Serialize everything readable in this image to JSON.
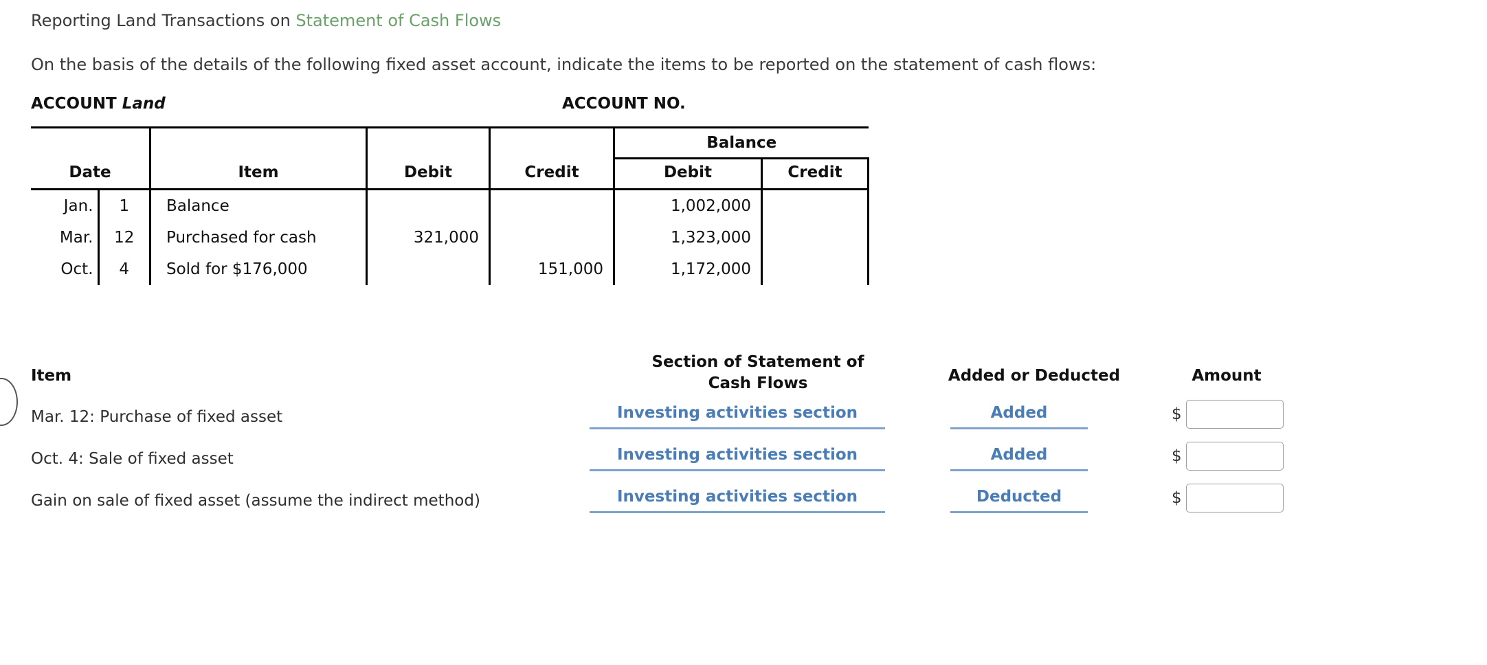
{
  "header": {
    "title_prefix": "Reporting Land Transactions on ",
    "title_link": "Statement of Cash Flows",
    "instructions": "On the basis of the details of the following fixed asset account, indicate the items to be reported on the statement of cash flows:"
  },
  "account": {
    "label": "ACCOUNT ",
    "name": "Land",
    "account_no_label": "ACCOUNT NO."
  },
  "ledger": {
    "balance_group_header": "Balance",
    "columns": {
      "date": "Date",
      "item": "Item",
      "debit": "Debit",
      "credit": "Credit",
      "bal_debit": "Debit",
      "bal_credit": "Credit"
    },
    "rows": [
      {
        "month": "Jan.",
        "day": "1",
        "item": "Balance",
        "debit": "",
        "credit": "",
        "bal_debit": "1,002,000",
        "bal_credit": ""
      },
      {
        "month": "Mar.",
        "day": "12",
        "item": "Purchased for cash",
        "debit": "321,000",
        "credit": "",
        "bal_debit": "1,323,000",
        "bal_credit": ""
      },
      {
        "month": "Oct.",
        "day": "4",
        "item": "Sold for $176,000",
        "debit": "",
        "credit": "151,000",
        "bal_debit": "1,172,000",
        "bal_credit": ""
      }
    ]
  },
  "answers": {
    "headers": {
      "item": "Item",
      "section_line1": "Section of Statement of",
      "section_line2": "Cash Flows",
      "added_or_deducted": "Added or Deducted",
      "amount": "Amount"
    },
    "currency_symbol": "$",
    "rows": [
      {
        "label": "Mar. 12: Purchase of fixed asset",
        "section": "Investing activities section",
        "added_or_deducted": "Added",
        "amount": "",
        "amount_placeholder": ""
      },
      {
        "label": "Oct. 4: Sale of fixed asset",
        "section": "Investing activities section",
        "added_or_deducted": "Added",
        "amount": "",
        "amount_placeholder": ""
      },
      {
        "label": "Gain on sale of fixed asset (assume the indirect method)",
        "section": "Investing activities section",
        "added_or_deducted": "Deducted",
        "amount": "",
        "amount_placeholder": ""
      }
    ]
  },
  "colors": {
    "link_green": "#6aa06a",
    "select_blue": "#4a7db5",
    "underline_blue": "#7ba3cc"
  }
}
